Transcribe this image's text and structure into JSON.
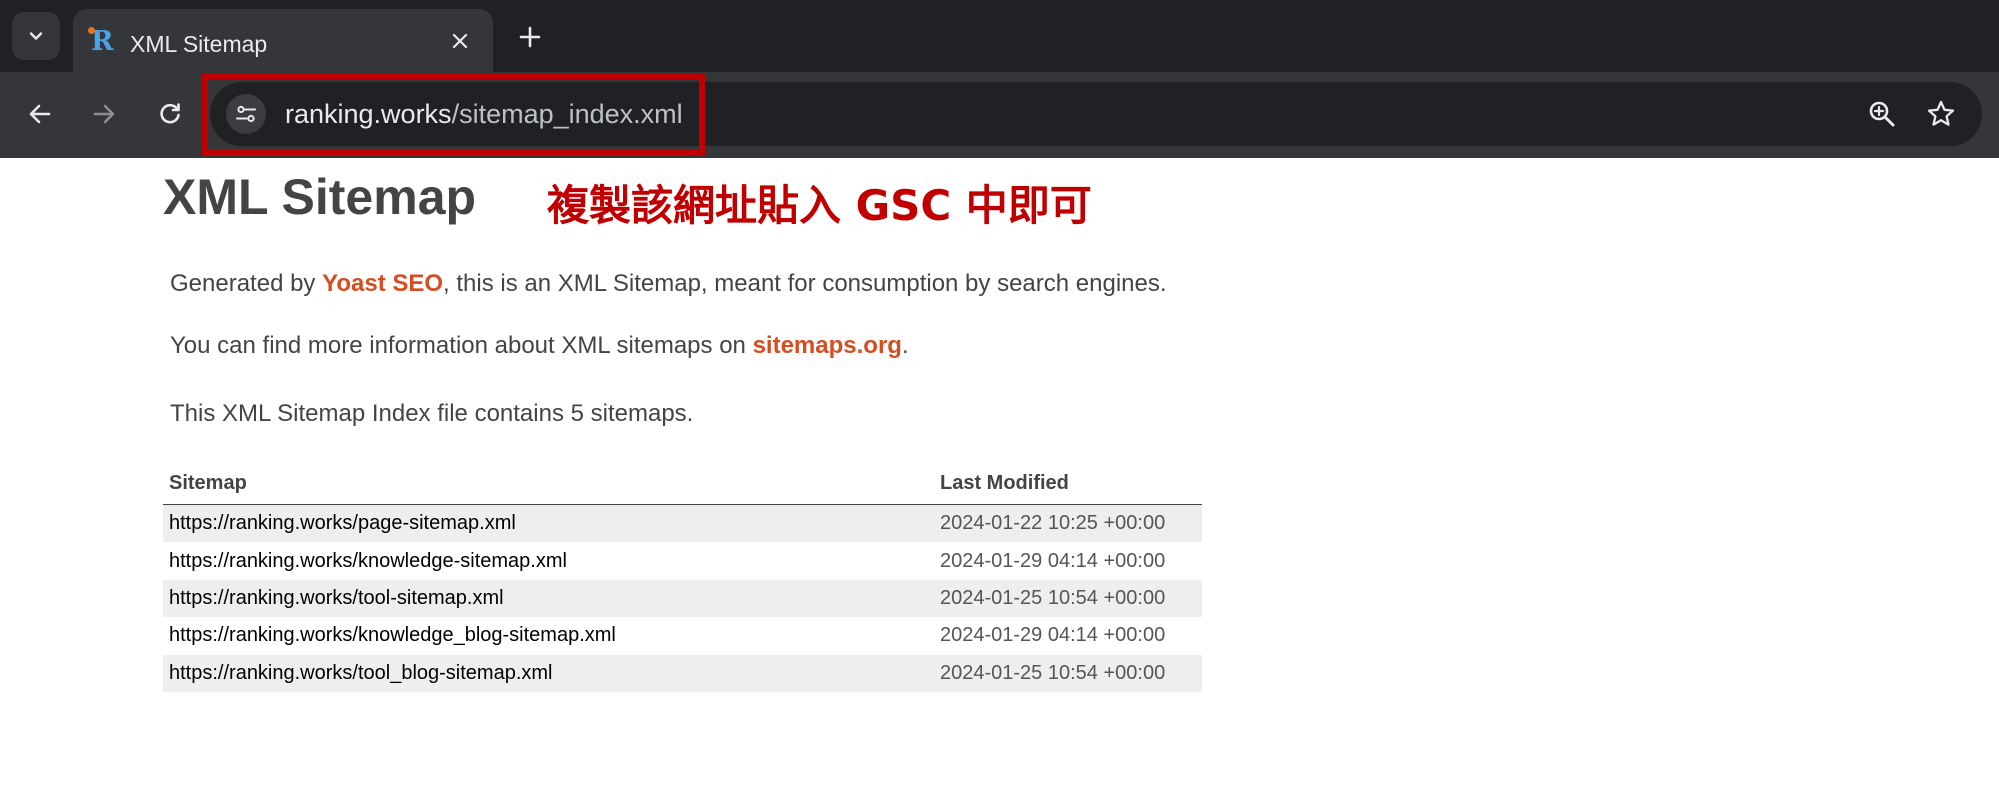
{
  "browser": {
    "tab_title": "XML Sitemap",
    "url_domain": "ranking.works",
    "url_path": "/sitemap_index.xml",
    "icons": {
      "tab_menu": "chevron-down-icon",
      "favicon": "site-favicon",
      "close": "close-icon",
      "new_tab": "plus-icon",
      "back": "arrow-left-icon",
      "forward": "arrow-right-icon",
      "reload": "reload-icon",
      "site_info": "tune-icon",
      "zoom": "zoom-in-icon",
      "bookmark": "star-icon"
    }
  },
  "annotation": {
    "text": "複製該網址貼入 GSC 中即可",
    "color": "#c00000"
  },
  "page": {
    "title": "XML Sitemap",
    "intro_1_prefix": "Generated by ",
    "intro_1_link": "Yoast SEO",
    "intro_1_suffix": ", this is an XML Sitemap, meant for consumption by search engines.",
    "intro_2_prefix": "You can find more information about XML sitemaps on ",
    "intro_2_link": "sitemaps.org",
    "intro_2_suffix": ".",
    "count_text": "This XML Sitemap Index file contains 5 sitemaps.",
    "link_color": "#d54e21"
  },
  "table": {
    "headers": {
      "sitemap": "Sitemap",
      "last_modified": "Last Modified"
    },
    "rows": [
      {
        "loc": "https://ranking.works/page-sitemap.xml",
        "lastmod": "2024-01-22 10:25 +00:00"
      },
      {
        "loc": "https://ranking.works/knowledge-sitemap.xml",
        "lastmod": "2024-01-29 04:14 +00:00"
      },
      {
        "loc": "https://ranking.works/tool-sitemap.xml",
        "lastmod": "2024-01-25 10:54 +00:00"
      },
      {
        "loc": "https://ranking.works/knowledge_blog-sitemap.xml",
        "lastmod": "2024-01-29 04:14 +00:00"
      },
      {
        "loc": "https://ranking.works/tool_blog-sitemap.xml",
        "lastmod": "2024-01-25 10:54 +00:00"
      }
    ]
  }
}
